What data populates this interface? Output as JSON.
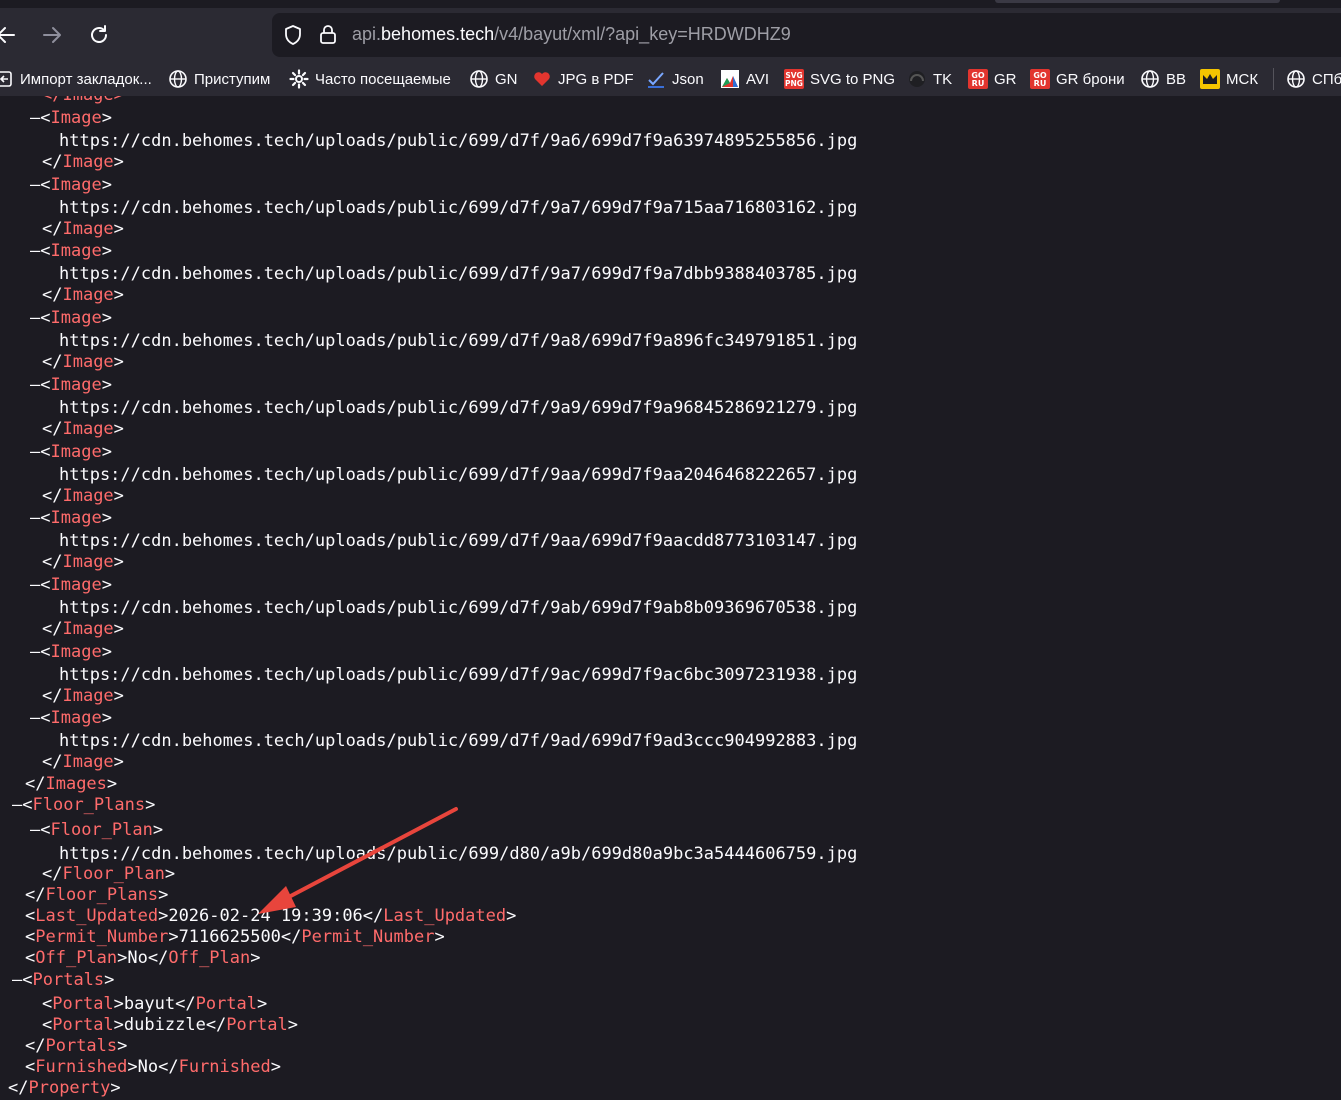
{
  "browser": {
    "url_host_prefix": "api.",
    "url_host": "behomes.tech",
    "url_path": "/v4/bayut/xml/?api_key=HRDWDHZ9"
  },
  "bookmarks": [
    {
      "label": "Импорт закладок...",
      "icon": "import-icon"
    },
    {
      "label": "Приступим",
      "icon": "globe-icon"
    },
    {
      "label": "Часто посещаемые",
      "icon": "gear-icon"
    },
    {
      "label": "GN",
      "icon": "globe-icon"
    },
    {
      "label": "JPG в PDF",
      "icon": "heart-icon"
    },
    {
      "label": "Json",
      "icon": "check-icon"
    },
    {
      "label": "AVI",
      "icon": "avi-icon"
    },
    {
      "label": "SVG to PNG",
      "icon": "svg-png-icon"
    },
    {
      "label": "TK",
      "icon": "tk-icon"
    },
    {
      "label": "GR",
      "icon": "goru-icon"
    },
    {
      "label": "GR брони",
      "icon": "goru-icon"
    },
    {
      "label": "BB",
      "icon": "globe-icon"
    },
    {
      "label": "МСК",
      "icon": "crown-icon"
    },
    {
      "label": "СПб",
      "icon": "globe-icon"
    }
  ],
  "xml": {
    "collapse_marker": "–",
    "top_partial": "</Image>",
    "image_tag": "Image",
    "images_tag": "Images",
    "image_urls": [
      "https://cdn.behomes.tech/uploads/public/699/d7f/9a6/699d7f9a63974895255856.jpg",
      "https://cdn.behomes.tech/uploads/public/699/d7f/9a7/699d7f9a715aa716803162.jpg",
      "https://cdn.behomes.tech/uploads/public/699/d7f/9a7/699d7f9a7dbb9388403785.jpg",
      "https://cdn.behomes.tech/uploads/public/699/d7f/9a8/699d7f9a896fc349791851.jpg",
      "https://cdn.behomes.tech/uploads/public/699/d7f/9a9/699d7f9a96845286921279.jpg",
      "https://cdn.behomes.tech/uploads/public/699/d7f/9aa/699d7f9aa2046468222657.jpg",
      "https://cdn.behomes.tech/uploads/public/699/d7f/9aa/699d7f9aacdd8773103147.jpg",
      "https://cdn.behomes.tech/uploads/public/699/d7f/9ab/699d7f9ab8b09369670538.jpg",
      "https://cdn.behomes.tech/uploads/public/699/d7f/9ac/699d7f9ac6bc3097231938.jpg",
      "https://cdn.behomes.tech/uploads/public/699/d7f/9ad/699d7f9ad3ccc904992883.jpg"
    ],
    "floor_plans_tag": "Floor_Plans",
    "floor_plan_tag": "Floor_Plan",
    "floor_plan_url": "https://cdn.behomes.tech/uploads/public/699/d80/a9b/699d80a9bc3a5444606759.jpg",
    "last_updated_tag": "Last_Updated",
    "last_updated": "2026-02-24 19:39:06",
    "permit_tag": "Permit_Number",
    "permit": "7116625500",
    "off_plan_tag": "Off_Plan",
    "off_plan": "No",
    "portals_tag": "Portals",
    "portal_tag": "Portal",
    "portals": [
      "bayut",
      "dubizzle"
    ],
    "furnished_tag": "Furnished",
    "furnished": "No",
    "property_tag": "Property"
  },
  "colors": {
    "tag": "#ff6b6b",
    "text": "#fbfbfe",
    "background": "#1c1b22",
    "annotation_arrow": "#e8453c"
  }
}
